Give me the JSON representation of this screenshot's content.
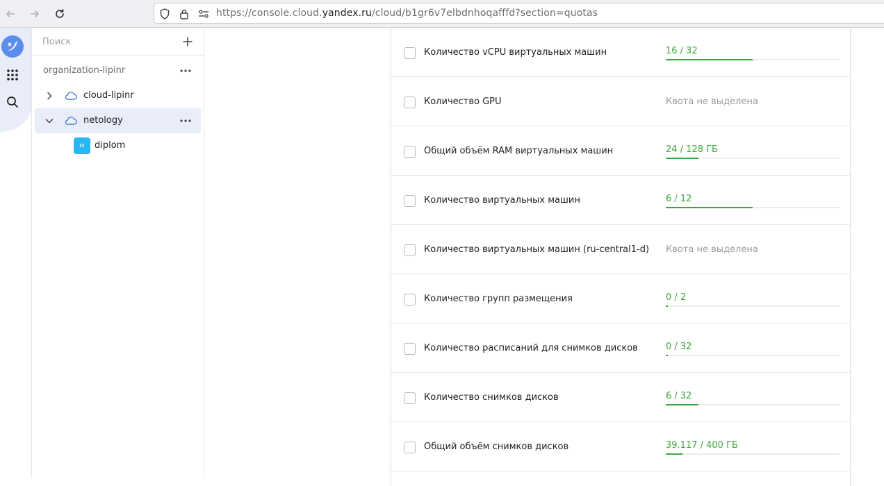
{
  "browser": {
    "url_prefix": "https://console.cloud.",
    "url_domain": "yandex.ru",
    "url_path": "/cloud/b1gr6v7elbdnhoqafffd?section=quotas"
  },
  "tree": {
    "search_placeholder": "Поиск",
    "organization": "organization-lipinr",
    "clouds": [
      {
        "label": "cloud-lipinr",
        "expanded": false,
        "selected": false
      },
      {
        "label": "netology",
        "expanded": true,
        "selected": true
      }
    ],
    "folder": {
      "badge": "DI",
      "label": "diplom"
    }
  },
  "quotas": [
    {
      "name": "Количество vCPU виртуальных машин",
      "value": "16 / 32",
      "fraction": 0.5,
      "allocated": true
    },
    {
      "name": "Количество GPU",
      "value": "Квота не выделена",
      "fraction": null,
      "allocated": false
    },
    {
      "name": "Общий объём RAM виртуальных машин",
      "value": "24 / 128 ГБ",
      "fraction": 0.1875,
      "allocated": true
    },
    {
      "name": "Количество виртуальных машин",
      "value": "6 / 12",
      "fraction": 0.5,
      "allocated": true
    },
    {
      "name": "Количество виртуальных машин (ru-central1-d)",
      "value": "Квота не выделена",
      "fraction": null,
      "allocated": false
    },
    {
      "name": "Количество групп размещения",
      "value": "0 / 2",
      "fraction": 0.0,
      "allocated": true
    },
    {
      "name": "Количество расписаний для снимков дисков",
      "value": "0 / 32",
      "fraction": 0.0,
      "allocated": true
    },
    {
      "name": "Количество снимков дисков",
      "value": "6 / 32",
      "fraction": 0.1875,
      "allocated": true
    },
    {
      "name": "Общий объём снимков дисков",
      "value": "39.117 / 400 ГБ",
      "fraction": 0.0978,
      "allocated": true
    }
  ],
  "colors": {
    "quota_green": "#3da63b",
    "selected_bg": "#e8edf9",
    "folder_badge": "#27b7f2",
    "cloud_icon": "#4a7ddf"
  }
}
